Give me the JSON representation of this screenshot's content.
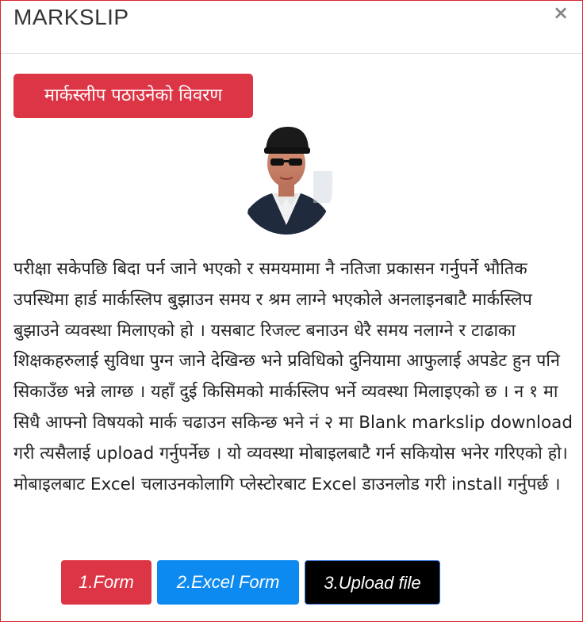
{
  "modal": {
    "title": "MARKSLIP",
    "close_symbol": "×"
  },
  "section_button": {
    "label": "मार्कस्लीप पठाउनेको विवरण"
  },
  "avatar": {
    "icon": "person-photo"
  },
  "description": "परीक्षा सकेपछि बिदा पर्न जाने भएको र समयमामा नै नतिजा प्रकासन गर्नुपर्ने भौतिक उपस्थिमा हार्ड मार्कस्लिप बुझाउन समय र श्रम लाग्ने भएकोले अनलाइनबाटै मार्कस्लिप बुझाउने व्यवस्था मिलाएको हो । यसबाट रिजल्ट बनाउन धेरै समय नलाग्ने र टाढाका शिक्षकहरुलाई सुविधा पुग्न जाने देखिन्छ भने प्रविधिको दुनियामा आफुलाई अपडेट हुन पनि सिकाउँछ भन्ने लाग्छ । यहाँ दुई किसिमको मार्कस्लिप भर्ने व्यवस्था मिलाइएको छ । न १ मा सिधै आफ्नो विषयको मार्क चढाउन सकिन्छ भने नं २ मा Blank markslip download गरी त्यसैलाई upload गर्नुपर्नेछ । यो व्यवस्था मोबाइलबाटै गर्न सकियोस भनेर गरिएको हो। मोबाइलबाट Excel चलाउनकोलागि प्लेस्टोरबाट Excel डाउनलोड गरी install गर्नुपर्छ ।",
  "actions": {
    "form_label": "1.Form",
    "excel_form_label": "2.Excel Form",
    "upload_label": "3.Upload file"
  },
  "colors": {
    "danger": "#dc3545",
    "primary": "#0d8af0",
    "dark": "#000000",
    "border": "#d8232a"
  }
}
